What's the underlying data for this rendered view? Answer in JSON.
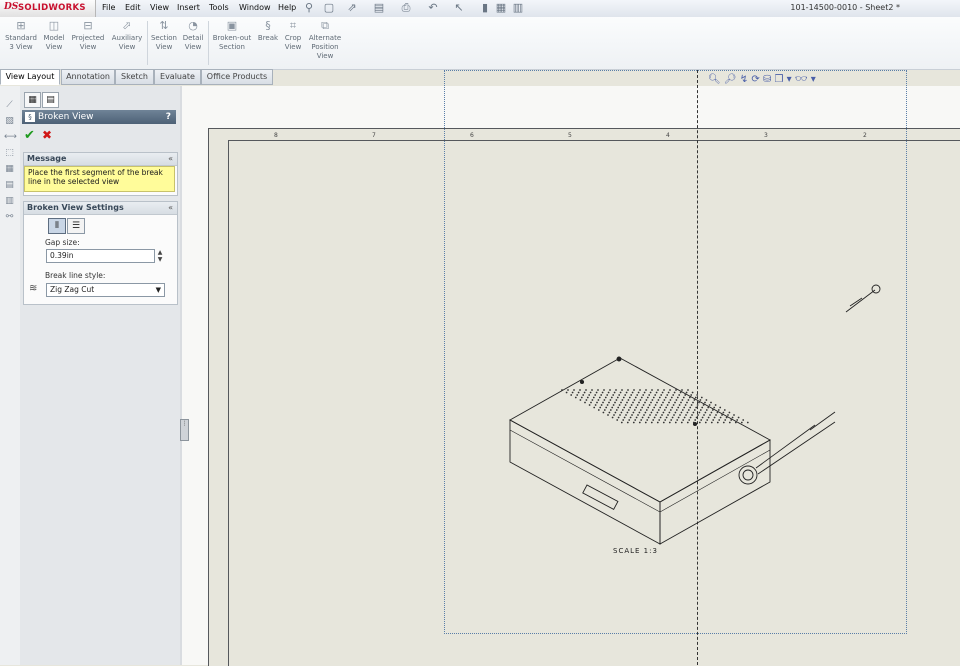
{
  "app": {
    "logo_ds": "DS",
    "logo_text": "SOLIDWORKS",
    "brand_color": "#c8102e",
    "document_title": "101-14500-0010 - Sheet2 *"
  },
  "menu": [
    "File",
    "Edit",
    "View",
    "Insert",
    "Tools",
    "Window",
    "Help"
  ],
  "ribbon": [
    {
      "label_line1": "Standard",
      "label_line2": "3 View",
      "icon": "standard-3-view-icon"
    },
    {
      "label_line1": "Model",
      "label_line2": "View",
      "icon": "model-view-icon"
    },
    {
      "label_line1": "Projected",
      "label_line2": "View",
      "icon": "projected-view-icon"
    },
    {
      "label_line1": "Auxiliary",
      "label_line2": "View",
      "icon": "auxiliary-view-icon"
    },
    {
      "label_line1": "Section",
      "label_line2": "View",
      "icon": "section-view-icon"
    },
    {
      "label_line1": "Detail",
      "label_line2": "View",
      "icon": "detail-view-icon"
    },
    {
      "label_line1": "Broken-out",
      "label_line2": "Section",
      "icon": "broken-out-section-icon"
    },
    {
      "label_line1": "Break",
      "label_line2": "",
      "icon": "break-icon"
    },
    {
      "label_line1": "Crop",
      "label_line2": "View",
      "icon": "crop-view-icon"
    },
    {
      "label_line1": "Alternate",
      "label_line2": "Position",
      "label_line3": "View",
      "icon": "alternate-position-view-icon"
    }
  ],
  "tabs": [
    "View Layout",
    "Annotation",
    "Sketch",
    "Evaluate",
    "Office Products"
  ],
  "active_tab": "View Layout",
  "property_manager": {
    "title": "Broken View",
    "help": "?",
    "message_header": "Message",
    "message": "Place the first segment of the break line in the selected view",
    "settings_header": "Broken View Settings",
    "gap_label": "Gap size:",
    "gap_value": "0.39in",
    "style_label": "Break line style:",
    "style_value": "Zig Zag Cut",
    "collapse_glyph": "«"
  },
  "drawing": {
    "scale_label": "SCALE 1:3",
    "zone_numbers_top": [
      "8",
      "7",
      "6",
      "5",
      "4",
      "3",
      "2"
    ]
  }
}
